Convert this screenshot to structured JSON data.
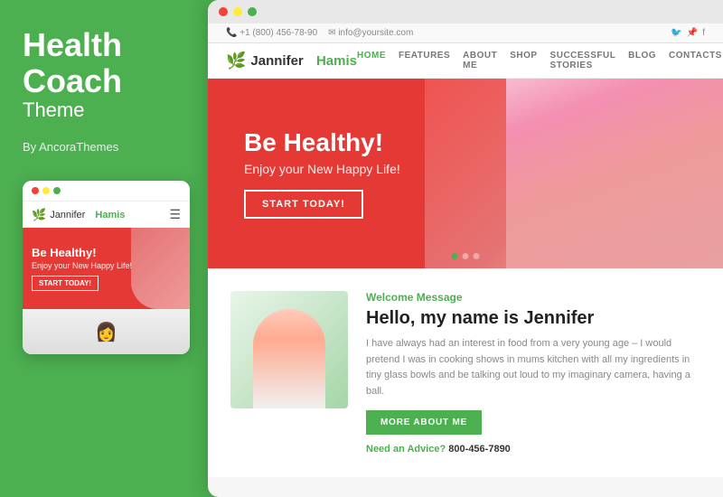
{
  "left": {
    "title_line1": "Health",
    "title_line2": "Coach",
    "subtitle": "Theme",
    "byline": "By AncoraThemes"
  },
  "mobile": {
    "dots": [
      "#f44336",
      "#ffeb3b",
      "#4caf50"
    ],
    "logo_first": "Jannifer",
    "logo_second": "Hamis",
    "hero_heading": "Be Healthy!",
    "hero_sub": "Enjoy your New Happy Life!",
    "hero_btn": "START TODAY!"
  },
  "browser": {
    "dots": [
      "#f44336",
      "#ffeb3b",
      "#4caf50"
    ]
  },
  "website": {
    "topbar": {
      "phone": "+1 (800) 456-78-90",
      "email": "info@yoursitе.com"
    },
    "nav": {
      "logo_first": "Jannifer",
      "logo_second": "Hamis",
      "links": [
        "HOME",
        "FEATURES",
        "ABOUT ME",
        "SHOP",
        "SUCCESSFUL STORIES",
        "BLOG",
        "CONTACTS"
      ]
    },
    "hero": {
      "heading": "Be Healthy!",
      "subheading": "Enjoy your New Happy Life!",
      "btn": "START TODAY!"
    },
    "about": {
      "subtitle": "Welcome Message",
      "title": "Hello, my name is Jennifer",
      "text": "I have always had an interest in food from a very young age – I would pretend I was in cooking shows in mums kitchen with all my ingredients in tiny glass bowls and be talking out loud to my imaginary camera, having a ball.",
      "btn": "MORE ABOUT ME",
      "advice_label": "Need an Advice?",
      "phone": "800-456-7890"
    }
  }
}
